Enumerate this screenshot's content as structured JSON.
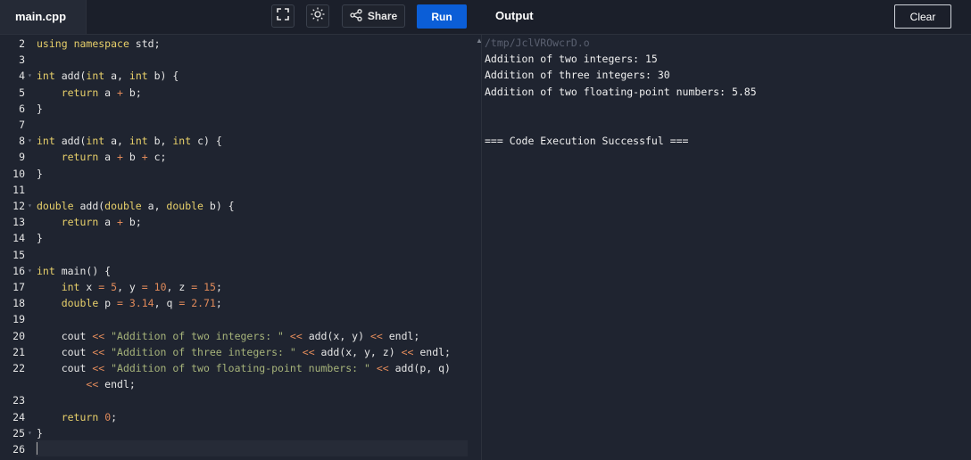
{
  "header": {
    "file_tab": "main.cpp",
    "share_label": "Share",
    "run_label": "Run",
    "output_title": "Output",
    "clear_label": "Clear",
    "icons": [
      "fullscreen-icon",
      "sun-icon",
      "share-icon"
    ]
  },
  "editor": {
    "lines": [
      {
        "n": "2",
        "fold": false,
        "html": "<span class=\"kw\">using</span> <span class=\"kw\">namespace</span> std;"
      },
      {
        "n": "3",
        "fold": false,
        "html": ""
      },
      {
        "n": "4",
        "fold": true,
        "html": "<span class=\"kw\">int</span> add(<span class=\"kw\">int</span> a, <span class=\"kw\">int</span> b) {"
      },
      {
        "n": "5",
        "fold": false,
        "html": "    <span class=\"kw\">return</span> a <span class=\"op\">+</span> b;"
      },
      {
        "n": "6",
        "fold": false,
        "html": "}"
      },
      {
        "n": "7",
        "fold": false,
        "html": ""
      },
      {
        "n": "8",
        "fold": true,
        "html": "<span class=\"kw\">int</span> add(<span class=\"kw\">int</span> a, <span class=\"kw\">int</span> b, <span class=\"kw\">int</span> c) {"
      },
      {
        "n": "9",
        "fold": false,
        "html": "    <span class=\"kw\">return</span> a <span class=\"op\">+</span> b <span class=\"op\">+</span> c;"
      },
      {
        "n": "10",
        "fold": false,
        "html": "}"
      },
      {
        "n": "11",
        "fold": false,
        "html": ""
      },
      {
        "n": "12",
        "fold": true,
        "html": "<span class=\"kw\">double</span> add(<span class=\"kw\">double</span> a, <span class=\"kw\">double</span> b) {"
      },
      {
        "n": "13",
        "fold": false,
        "html": "    <span class=\"kw\">return</span> a <span class=\"op\">+</span> b;"
      },
      {
        "n": "14",
        "fold": false,
        "html": "}"
      },
      {
        "n": "15",
        "fold": false,
        "html": ""
      },
      {
        "n": "16",
        "fold": true,
        "html": "<span class=\"kw\">int</span> main() {"
      },
      {
        "n": "17",
        "fold": false,
        "html": "    <span class=\"kw\">int</span> x <span class=\"op\">=</span> <span class=\"num\">5</span>, y <span class=\"op\">=</span> <span class=\"num\">10</span>, z <span class=\"op\">=</span> <span class=\"num\">15</span>;"
      },
      {
        "n": "18",
        "fold": false,
        "html": "    <span class=\"kw\">double</span> p <span class=\"op\">=</span> <span class=\"num\">3.14</span>, q <span class=\"op\">=</span> <span class=\"num\">2.71</span>;"
      },
      {
        "n": "19",
        "fold": false,
        "html": ""
      },
      {
        "n": "20",
        "fold": false,
        "html": "    cout <span class=\"op\">&lt;&lt;</span> <span class=\"str\">\"Addition of two integers: \"</span> <span class=\"op\">&lt;&lt;</span> add(x, y) <span class=\"op\">&lt;&lt;</span> endl;"
      },
      {
        "n": "21",
        "fold": false,
        "html": "    cout <span class=\"op\">&lt;&lt;</span> <span class=\"str\">\"Addition of three integers: \"</span> <span class=\"op\">&lt;&lt;</span> add(x, y, z) <span class=\"op\">&lt;&lt;</span> endl;"
      },
      {
        "n": "22",
        "fold": false,
        "html": "    cout <span class=\"op\">&lt;&lt;</span> <span class=\"str\">\"Addition of two floating-point numbers: \"</span> <span class=\"op\">&lt;&lt;</span> add(p, q)"
      },
      {
        "n": "",
        "fold": false,
        "html": "        <span class=\"op\">&lt;&lt;</span> endl;"
      },
      {
        "n": "23",
        "fold": false,
        "html": ""
      },
      {
        "n": "24",
        "fold": false,
        "html": "    <span class=\"kw\">return</span> <span class=\"num\">0</span>;"
      },
      {
        "n": "25",
        "fold": true,
        "html": "}"
      },
      {
        "n": "26",
        "fold": false,
        "html": ""
      }
    ]
  },
  "output": {
    "path": "/tmp/JclVROwcrD.o",
    "lines": [
      "Addition of two integers: 15",
      "Addition of three integers: 30",
      "Addition of two floating-point numbers: 5.85",
      "",
      "",
      "=== Code Execution Successful ==="
    ]
  }
}
